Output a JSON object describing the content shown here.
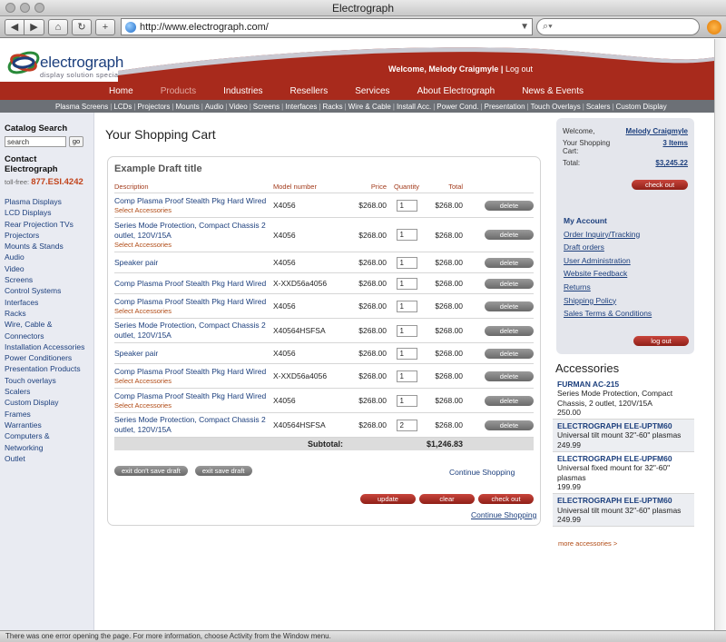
{
  "window": {
    "title": "Electrograph"
  },
  "browser": {
    "url": "http://www.electrograph.com/",
    "status": "There was one error opening the page. For more information, choose Activity from the Window menu."
  },
  "header": {
    "logo_text": "electrograph",
    "logo_tagline": "display solution specialists",
    "welcome": "Welcome, Melody Craigmyle",
    "separator": "|",
    "logout": "Log out"
  },
  "main_nav": [
    {
      "label": "Home",
      "active": false
    },
    {
      "label": "Products",
      "active": true
    },
    {
      "label": "Industries",
      "active": false
    },
    {
      "label": "Resellers",
      "active": false
    },
    {
      "label": "Services",
      "active": false
    },
    {
      "label": "About Electrograph",
      "active": false
    },
    {
      "label": "News & Events",
      "active": false
    }
  ],
  "sub_nav": [
    "Plasma Screens",
    "LCDs",
    "Projectors",
    "Mounts",
    "Audio",
    "Video",
    "Screens",
    "Interfaces",
    "Racks",
    "Wire & Cable",
    "Install Acc.",
    "Power Cond.",
    "Presentation",
    "Touch Overlays",
    "Scalers",
    "Custom Display"
  ],
  "sidebar": {
    "search_title": "Catalog Search",
    "search_value": "search",
    "search_go": "go",
    "contact_title": "Contact Electrograph",
    "tollfree_label": "toll-free:",
    "tollfree_number": "877.ESI.4242",
    "categories": [
      "Plasma Displays",
      "LCD Displays",
      "Rear Projection TVs",
      "Projectors",
      "Mounts & Stands",
      "Audio",
      "Video",
      "Screens",
      "Control Systems",
      "Interfaces",
      "Racks",
      "Wire, Cable & Connectors",
      "Installation Accessories",
      "Power Conditioners",
      "Presentation Products",
      "Touch overlays",
      "Scalers",
      "Custom Display",
      "Frames",
      "Warranties",
      "Computers & Networking",
      "Outlet"
    ]
  },
  "cart": {
    "page_title": "Your Shopping Cart",
    "draft_title": "Example Draft title",
    "columns": {
      "description": "Description",
      "model": "Model number",
      "price": "Price",
      "quantity": "Quantity",
      "total": "Total"
    },
    "accessories_link": "Select Accessories",
    "delete_label": "delete",
    "rows": [
      {
        "desc": "Comp Plasma Proof Stealth Pkg Hard Wired",
        "acc": true,
        "model": "X4056",
        "price": "$268.00",
        "qty": "1",
        "total": "$268.00"
      },
      {
        "desc": "Series Mode Protection, Compact Chassis 2 outlet, 120V/15A",
        "acc": true,
        "model": "X4056",
        "price": "$268.00",
        "qty": "1",
        "total": "$268.00"
      },
      {
        "desc": "Speaker pair",
        "acc": false,
        "model": "X4056",
        "price": "$268.00",
        "qty": "1",
        "total": "$268.00"
      },
      {
        "desc": "Comp Plasma Proof Stealth Pkg Hard Wired",
        "acc": false,
        "model": "X-XXD56a4056",
        "price": "$268.00",
        "qty": "1",
        "total": "$268.00"
      },
      {
        "desc": "Comp Plasma Proof Stealth Pkg Hard Wired",
        "acc": true,
        "model": "X4056",
        "price": "$268.00",
        "qty": "1",
        "total": "$268.00"
      },
      {
        "desc": "Series Mode Protection, Compact Chassis 2 outlet, 120V/15A",
        "acc": false,
        "model": "X40564HSFSA",
        "price": "$268.00",
        "qty": "1",
        "total": "$268.00"
      },
      {
        "desc": "Speaker pair",
        "acc": false,
        "model": "X4056",
        "price": "$268.00",
        "qty": "1",
        "total": "$268.00"
      },
      {
        "desc": "Comp Plasma Proof Stealth Pkg Hard Wired",
        "acc": true,
        "model": "X-XXD56a4056",
        "price": "$268.00",
        "qty": "1",
        "total": "$268.00"
      },
      {
        "desc": "Comp Plasma Proof Stealth Pkg Hard Wired",
        "acc": true,
        "model": "X4056",
        "price": "$268.00",
        "qty": "1",
        "total": "$268.00"
      },
      {
        "desc": "Series Mode Protection, Compact Chassis 2 outlet, 120V/15A",
        "acc": false,
        "model": "X40564HSFSA",
        "price": "$268.00",
        "qty": "2",
        "total": "$268.00"
      }
    ],
    "subtotal_label": "Subtotal:",
    "subtotal_value": "$1,246.83",
    "exit_dont_save": "exit don't save draft",
    "exit_save": "exit save draft",
    "continue_shopping": "Continue Shopping",
    "update": "update",
    "clear": "clear",
    "checkout": "check out"
  },
  "account": {
    "welcome_label": "Welcome,",
    "user_name": "Melody Craigmyle",
    "cart_label": "Your Shopping Cart:",
    "cart_items": "3 Items",
    "total_label": "Total:",
    "total_value": "$3,245.22",
    "checkout": "check out",
    "links_title": "My Account",
    "links": [
      "Order Inquiry/Tracking",
      "Draft orders",
      "User Administration",
      "Website Feedback",
      "Returns",
      "Shipping Policy",
      "Sales Terms & Conditions"
    ],
    "logout": "log out"
  },
  "accessories": {
    "title": "Accessories",
    "items": [
      {
        "name": "FURMAN AC-215",
        "desc": "Series Mode Protection, Compact Chassis, 2 outlet, 120V/15A",
        "price": "250.00"
      },
      {
        "name": "ELECTROGRAPH ELE-UPTM60",
        "desc": "Universal tilt mount 32\"-60\" plasmas",
        "price": "249.99"
      },
      {
        "name": "ELECTROGRAPH ELE-UPFM60",
        "desc": "Universal fixed mount for 32\"-60\" plasmas",
        "price": "199.99"
      },
      {
        "name": "ELECTROGRAPH ELE-UPTM60",
        "desc": "Universal tilt mount 32\"-60\" plasmas",
        "price": "249.99"
      }
    ],
    "more": "more accessories >"
  },
  "colors": {
    "brand_red": "#a82a1c",
    "link_blue": "#1c3f7d",
    "accent_orange": "#c2451d"
  }
}
